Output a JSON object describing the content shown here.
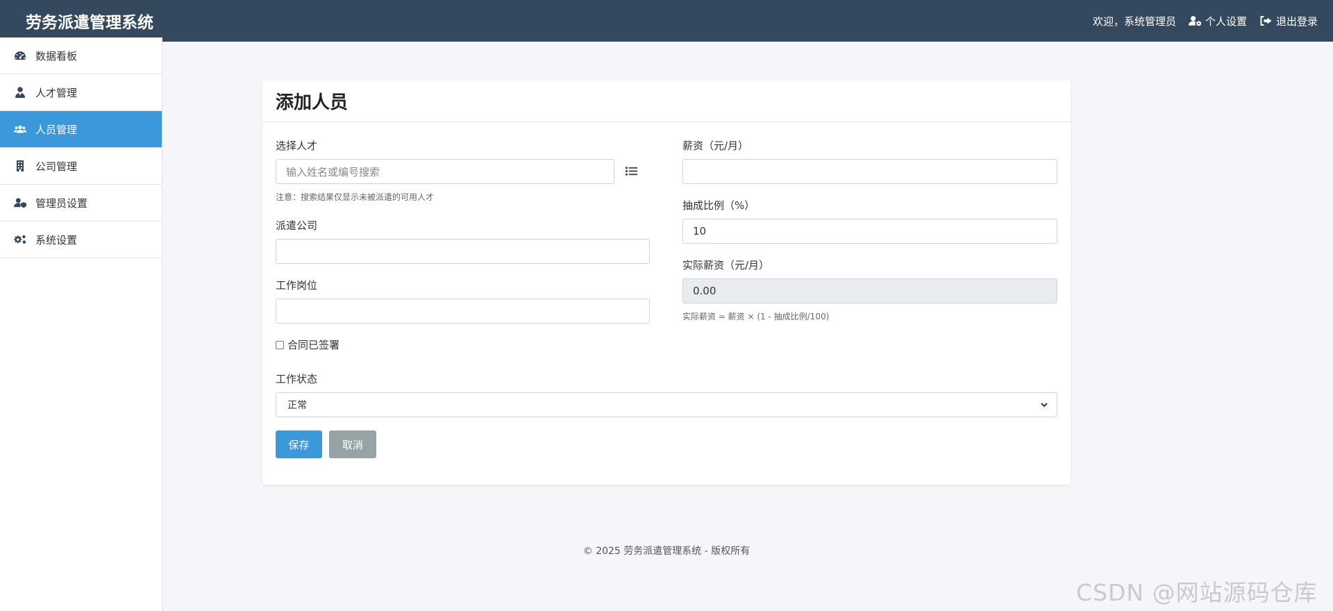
{
  "header": {
    "brand": "劳务派遣管理系统",
    "welcome": "欢迎，系统管理员",
    "profile_label": "个人设置",
    "logout_label": "退出登录"
  },
  "sidebar": {
    "items": [
      {
        "label": "数据看板",
        "icon": "dashboard-icon"
      },
      {
        "label": "人才管理",
        "icon": "user-tie-icon"
      },
      {
        "label": "人员管理",
        "icon": "users-icon",
        "active": true
      },
      {
        "label": "公司管理",
        "icon": "building-icon"
      },
      {
        "label": "管理员设置",
        "icon": "user-shield-icon"
      },
      {
        "label": "系统设置",
        "icon": "cogs-icon"
      }
    ]
  },
  "form": {
    "title": "添加人员",
    "talent": {
      "label": "选择人才",
      "placeholder": "输入姓名或编号搜索",
      "value": "",
      "hint": "注意：搜索结果仅显示未被派遣的可用人才"
    },
    "company": {
      "label": "派遣公司",
      "value": ""
    },
    "position": {
      "label": "工作岗位",
      "value": ""
    },
    "contract": {
      "label": "合同已签署",
      "checked": false
    },
    "salary": {
      "label": "薪资（元/月）",
      "value": ""
    },
    "commission": {
      "label": "抽成比例（%）",
      "value": "10"
    },
    "actual_salary": {
      "label": "实际薪资（元/月）",
      "value": "0.00",
      "hint": "实际薪资 = 薪资 × (1 - 抽成比例/100)"
    },
    "status": {
      "label": "工作状态",
      "selected": "正常"
    },
    "save_label": "保存",
    "cancel_label": "取消"
  },
  "footer": {
    "text": "© 2025 劳务派遣管理系统 - 版权所有"
  },
  "watermark": "CSDN @网站源码仓库",
  "colors": {
    "topbar": "#34495e",
    "accent": "#3a98db",
    "cancel": "#95a5a6",
    "background": "#f4f6f9"
  }
}
